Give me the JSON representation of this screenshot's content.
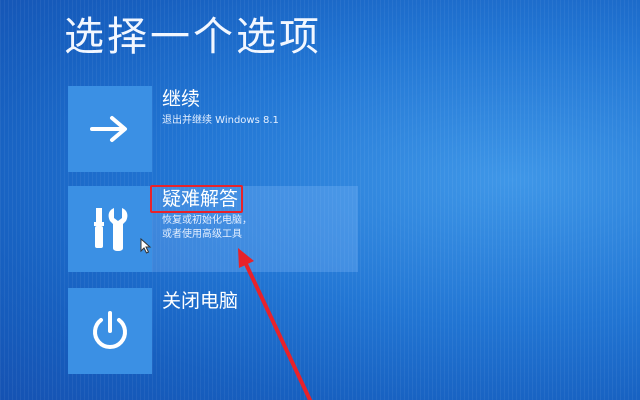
{
  "page": {
    "title": "选择一个选项"
  },
  "options": [
    {
      "title": "继续",
      "desc_lines": [
        "退出并继续 Windows 8.1"
      ],
      "icon": "arrow-right-icon"
    },
    {
      "title": "疑难解答",
      "desc_lines": [
        "恢复或初始化电脑，",
        "或者使用高级工具"
      ],
      "icon": "tools-icon"
    },
    {
      "title": "关闭电脑",
      "desc_lines": [],
      "icon": "power-icon"
    }
  ],
  "annotation": {
    "color": "#e8222a"
  },
  "colors": {
    "background": "#1f6fd0",
    "tile": "#3b90e4",
    "text": "#ffffff"
  }
}
